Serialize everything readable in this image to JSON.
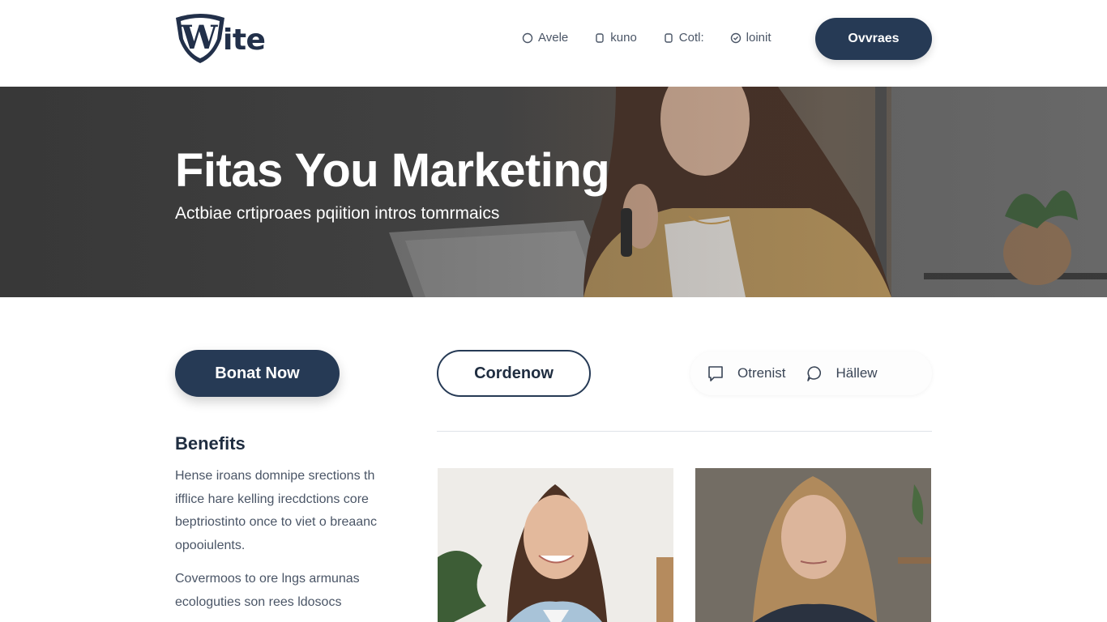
{
  "header": {
    "logo_text": "ite",
    "logo_mark_letter": "W",
    "nav": [
      {
        "label": "Avele",
        "icon": "circle-icon"
      },
      {
        "label": "kuno",
        "icon": "tag-icon"
      },
      {
        "label": "Cotl:",
        "icon": "tag-icon"
      },
      {
        "label": "loinit",
        "icon": "check-circle-icon"
      }
    ],
    "cta_label": "Ovvraes"
  },
  "hero": {
    "title": "Fitas You Marketing",
    "subtitle": "Actbiae crtiproaes pqiition intros tomrmaics"
  },
  "buttons": {
    "primary_label": "Bonat Now",
    "outline_label": "Cordenow"
  },
  "actions": [
    {
      "label": "Otrenist",
      "icon": "comment-square-icon"
    },
    {
      "label": "Hällew",
      "icon": "chat-bubble-icon"
    }
  ],
  "benefits": {
    "title": "Benefits",
    "paragraph1": "Hense iroans domnipe srections th ifflice hare kelling irecdctions core beptriostinto once to viet o breaanc opooiulents.",
    "paragraph2": "Covermoos to ore lngs armunas ecologuties son rees ldosocs"
  },
  "colors": {
    "brand_navy": "#263a55",
    "text_dark": "#1f2d40",
    "text_muted": "#4a5566"
  }
}
